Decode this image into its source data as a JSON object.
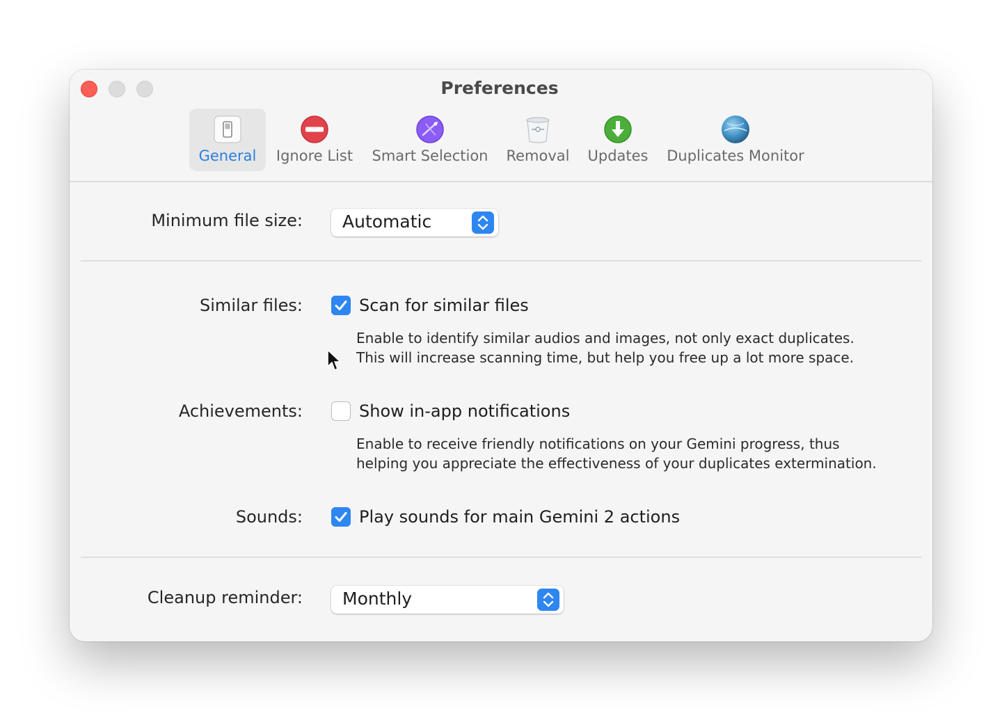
{
  "window": {
    "title": "Preferences"
  },
  "toolbar": {
    "tabs": [
      {
        "label": "General",
        "icon": "general-switch-icon",
        "active": true
      },
      {
        "label": "Ignore List",
        "icon": "no-entry-icon",
        "active": false
      },
      {
        "label": "Smart Selection",
        "icon": "smart-selection-icon",
        "active": false
      },
      {
        "label": "Removal",
        "icon": "trash-can-icon",
        "active": false
      },
      {
        "label": "Updates",
        "icon": "download-arrow-icon",
        "active": false
      },
      {
        "label": "Duplicates Monitor",
        "icon": "globe-monitor-icon",
        "active": false
      }
    ]
  },
  "settings": {
    "min_file_size": {
      "label": "Minimum file size:",
      "value": "Automatic"
    },
    "similar_files": {
      "label": "Similar files:",
      "checkbox_label": "Scan for similar files",
      "checked": true,
      "description_line1": "Enable to identify similar audios and images, not only exact duplicates.",
      "description_line2": "This will increase scanning time, but help you free up a lot more space."
    },
    "achievements": {
      "label": "Achievements:",
      "checkbox_label": "Show in-app notifications",
      "checked": false,
      "description_line1": "Enable to receive friendly notifications on your Gemini progress, thus",
      "description_line2": "helping you appreciate the effectiveness of your duplicates extermination."
    },
    "sounds": {
      "label": "Sounds:",
      "checkbox_label": "Play sounds for main Gemini 2 actions",
      "checked": true
    },
    "cleanup_reminder": {
      "label": "Cleanup reminder:",
      "value": "Monthly"
    }
  },
  "colors": {
    "accent": "#2e86f0",
    "active_tab_label": "#2a7fe0",
    "close_button": "#fe5f57",
    "window_bg": "#f5f5f5"
  }
}
